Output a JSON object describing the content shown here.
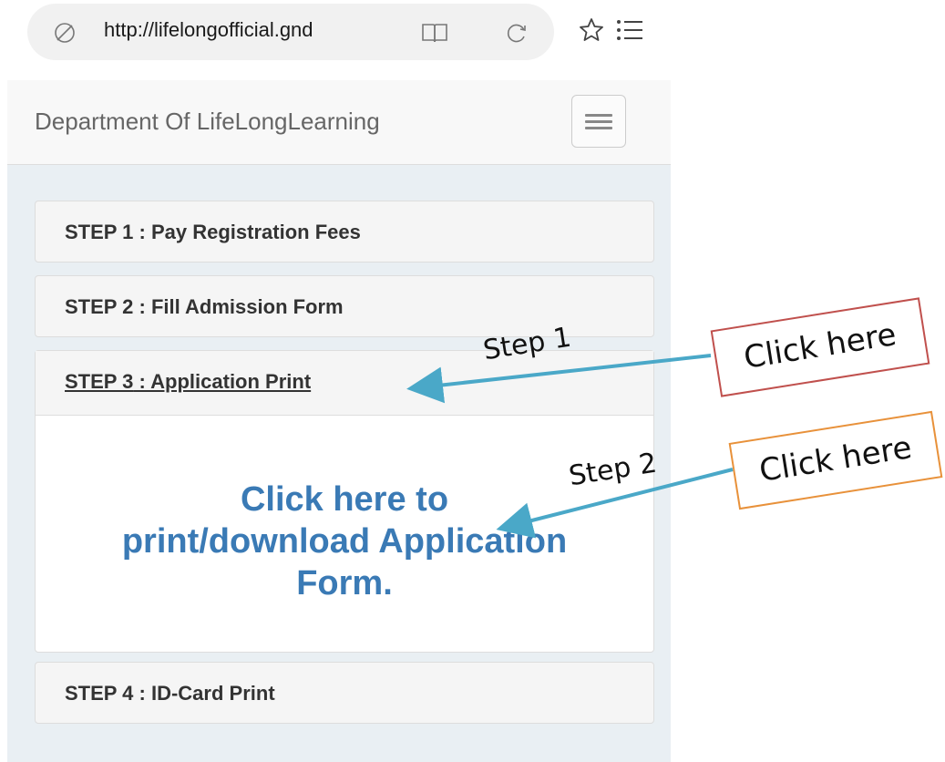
{
  "browser": {
    "url": "http://lifelongofficial.gnd",
    "icons": [
      "lock-icon",
      "reader-view-icon",
      "refresh-icon",
      "bookmark-star-icon",
      "menu-list-icon"
    ]
  },
  "site": {
    "brand": "Department Of LifeLongLearning",
    "nav_toggle_icon": "hamburger-icon",
    "steps": [
      {
        "label": "STEP 1",
        "title": " : Pay Registration Fees"
      },
      {
        "label": "STEP 2",
        "title": " : Fill Admission Form"
      },
      {
        "label": "STEP 3",
        "title": " : Application Print"
      },
      {
        "label": "STEP 4",
        "title": " : ID-Card Print"
      }
    ],
    "download_link": {
      "line1": "Click here to",
      "line2": "print/download Application",
      "line3": "Form."
    }
  },
  "annotations": {
    "step1_label": "Step 1",
    "step2_label": "Step 2",
    "callout1": "Click here",
    "callout2": "Click here",
    "arrow_color": "#4aa8c8",
    "callout1_border": "#c0504d",
    "callout2_border": "#e8913a"
  },
  "colors": {
    "link": "#3a7ab5",
    "page_bg": "#e9eff3",
    "panel_bg": "#f5f5f5"
  }
}
